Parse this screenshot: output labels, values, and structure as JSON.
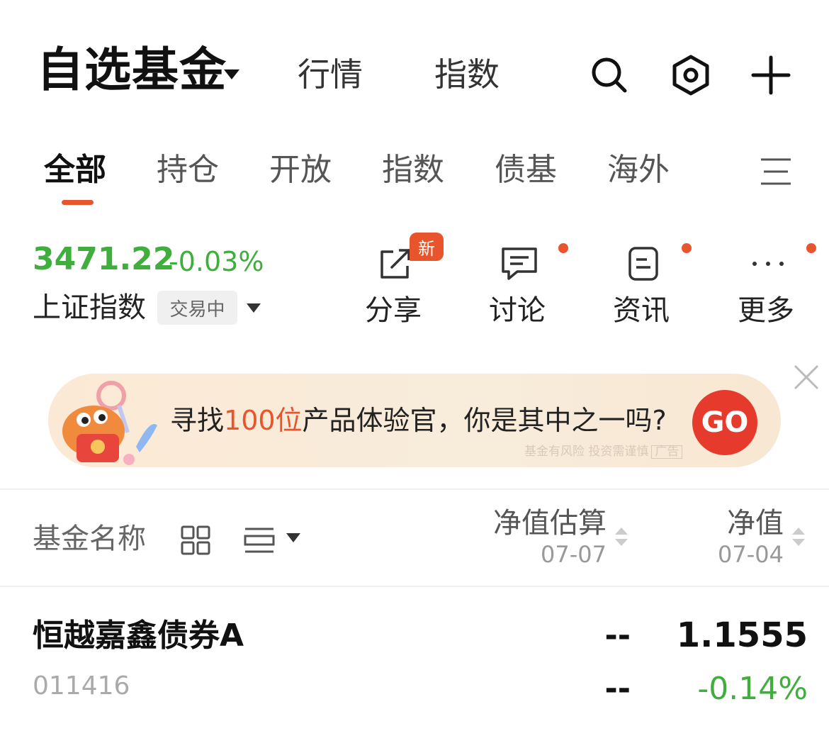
{
  "header": {
    "title": "自选基金",
    "tabs": [
      "行情",
      "指数"
    ]
  },
  "categories": [
    "全部",
    "持仓",
    "开放",
    "指数",
    "债基",
    "海外"
  ],
  "index": {
    "value": "3471.22",
    "change": "-0.03%",
    "name": "上证指数",
    "status": "交易中"
  },
  "actions": {
    "share": "分享",
    "new_badge": "新",
    "discuss": "讨论",
    "news": "资讯",
    "more": "更多"
  },
  "banner": {
    "text_before": "寻找",
    "text_highlight": "100位",
    "text_after": "产品体验官，你是其中之一吗?",
    "go": "GO",
    "risk_note": "基金有风险 投资需谨慎",
    "ad_tag": "广告"
  },
  "table": {
    "name_header": "基金名称",
    "est_header": "净值估算",
    "est_date": "07-07",
    "nav_header": "净值",
    "nav_date": "07-04"
  },
  "rows": [
    {
      "name": "恒越嘉鑫债券A",
      "code": "011416",
      "est_value": "--",
      "est_change": "--",
      "nav": "1.1555",
      "nav_change": "-0.14%"
    }
  ],
  "colors": {
    "accent": "#e8542c",
    "down_green": "#3fae3d",
    "go_red": "#e63a2c"
  }
}
